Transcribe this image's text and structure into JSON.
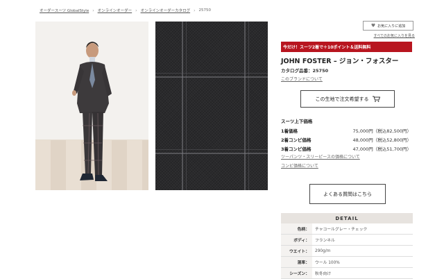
{
  "breadcrumb": {
    "items": [
      "オーダースーツ GlobalStyle",
      "オンラインオーダー",
      "オンラインオーダーカタログ"
    ],
    "current": "25750"
  },
  "favorites": {
    "button_label": "お気に入りに追加",
    "link_label": "すべてのお気に入りを見る"
  },
  "promo": {
    "text": "今だけ！スーツ2着で＋10ポイント＆送料無料"
  },
  "product": {
    "title": "JOHN FOSTER – ジョン・フォスター",
    "catalog": "カタログ品番：25750",
    "brand_link": "このブランドについて",
    "order_button": "この生地で注文希望する"
  },
  "prices": {
    "heading": "スーツ上下価格",
    "rows": [
      {
        "label": "1着価格",
        "value": "75,000円（税込82,500円）"
      },
      {
        "label": "2着コンビ価格",
        "value": "48,000円（税込52,800円）"
      },
      {
        "label": "3着コンビ価格",
        "value": "47,000円（税込51,700円）"
      }
    ],
    "link1": "ツーパンツ・スリーピースの価格について",
    "link2": "コンビ価格について"
  },
  "faq_button": "よくある質問はこちら",
  "detail": {
    "heading": "DETAIL",
    "rows": [
      {
        "label": "色柄：",
        "value": "チャコールグレー・チェック"
      },
      {
        "label": "ボディ：",
        "value": "フランネル"
      },
      {
        "label": "ウエイト：",
        "value": "290g/m"
      },
      {
        "label": "混率：",
        "value": "ウール 100%"
      },
      {
        "label": "シーズン：",
        "value": "秋冬向け"
      }
    ]
  },
  "colors": {
    "promo_red": "#b8151f",
    "detail_header_bg": "#e7e3df"
  },
  "icons": [
    "chevron-right-icon",
    "heart-icon",
    "cart-icon"
  ]
}
